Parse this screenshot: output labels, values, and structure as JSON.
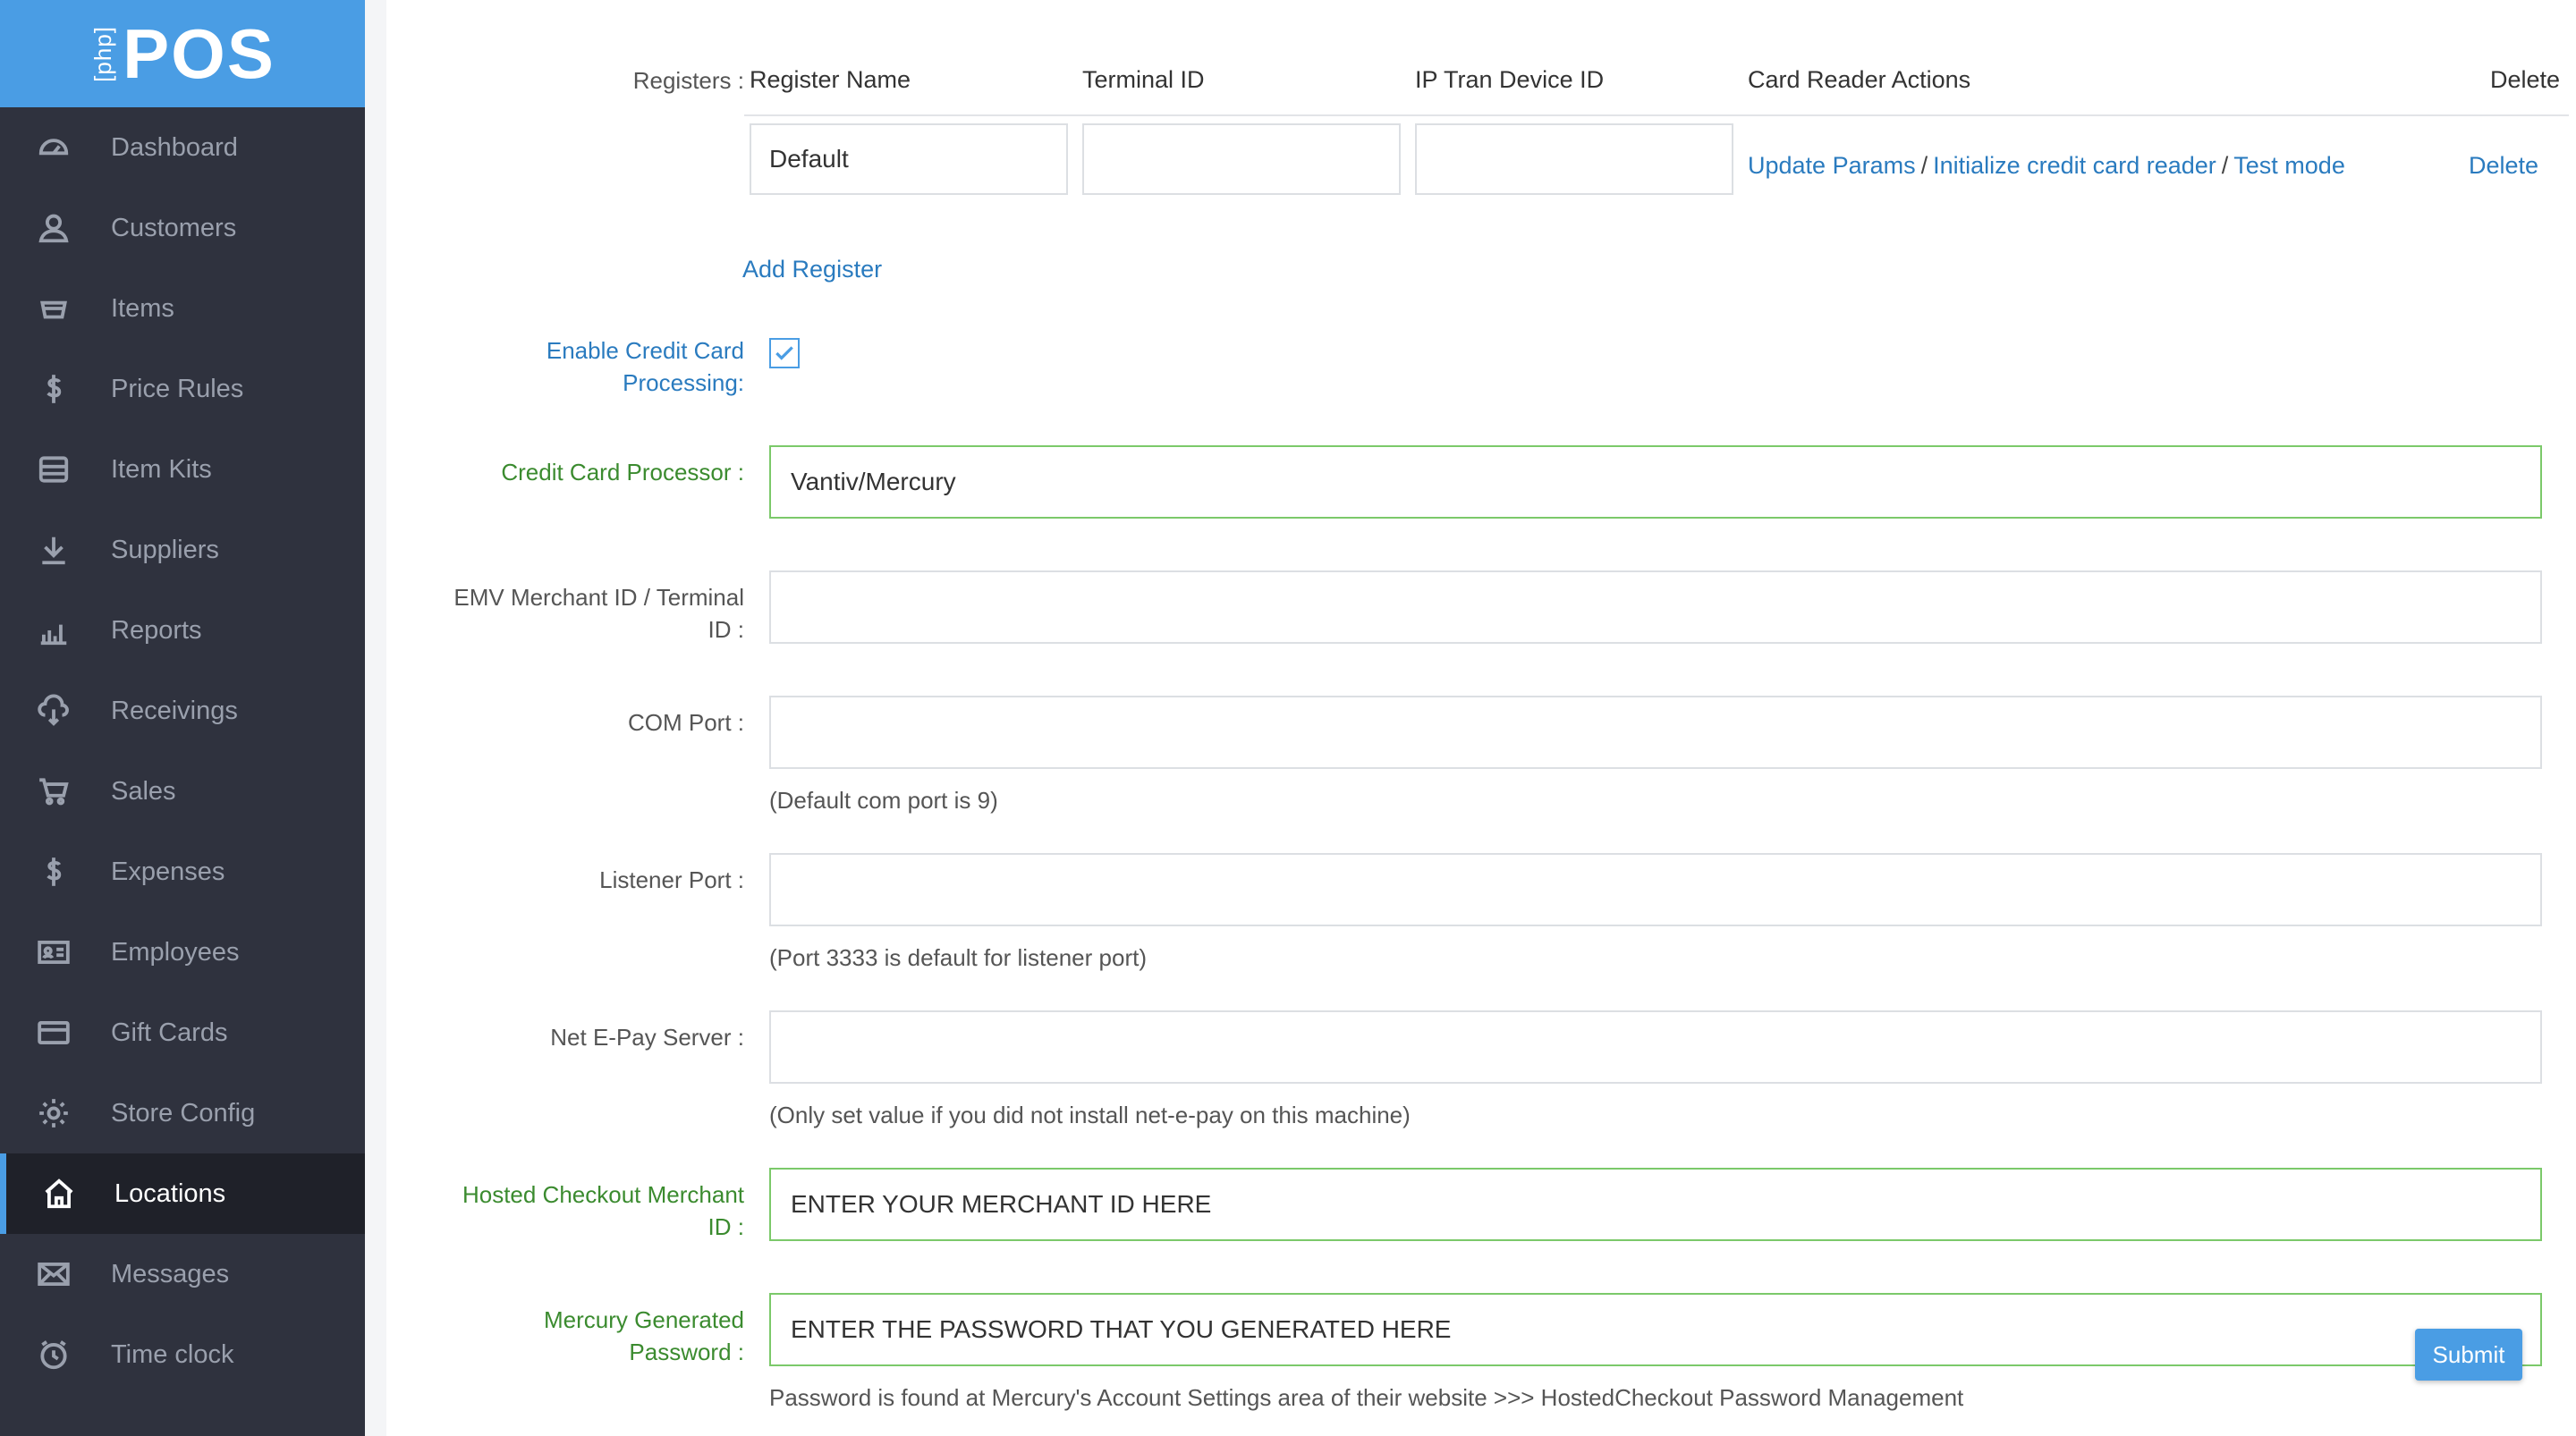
{
  "app": {
    "logo_prefix": "[php]",
    "logo_text": "POS",
    "brand_color": "#4a9de4"
  },
  "sidebar": {
    "items": [
      {
        "label": "Dashboard",
        "icon": "dashboard-icon"
      },
      {
        "label": "Customers",
        "icon": "user-icon"
      },
      {
        "label": "Items",
        "icon": "box-icon"
      },
      {
        "label": "Price Rules",
        "icon": "dollar-icon"
      },
      {
        "label": "Item Kits",
        "icon": "kit-icon"
      },
      {
        "label": "Suppliers",
        "icon": "download-icon"
      },
      {
        "label": "Reports",
        "icon": "bar-chart-icon"
      },
      {
        "label": "Receivings",
        "icon": "cloud-download-icon"
      },
      {
        "label": "Sales",
        "icon": "cart-icon"
      },
      {
        "label": "Expenses",
        "icon": "dollar-icon"
      },
      {
        "label": "Employees",
        "icon": "id-card-icon"
      },
      {
        "label": "Gift Cards",
        "icon": "credit-card-icon"
      },
      {
        "label": "Store Config",
        "icon": "gear-icon"
      },
      {
        "label": "Locations",
        "icon": "home-icon",
        "active": true
      },
      {
        "label": "Messages",
        "icon": "envelope-icon"
      },
      {
        "label": "Time clock",
        "icon": "clock-icon"
      }
    ]
  },
  "registers": {
    "label": "Registers :",
    "columns": [
      "Register Name",
      "Terminal ID",
      "IP Tran Device ID",
      "Card Reader Actions",
      "Delete"
    ],
    "rows": [
      {
        "register_name": "Default",
        "terminal_id": "",
        "ip_tran_device_id": "",
        "actions": [
          "Update Params",
          "Initialize credit card reader",
          "Test mode"
        ],
        "delete": "Delete"
      }
    ],
    "add_label": "Add Register",
    "separator": "/"
  },
  "form": {
    "enable_cc": {
      "label_line1": "Enable Credit Card",
      "label_line2": "Processing:",
      "checked": true
    },
    "processor": {
      "label": "Credit Card Processor :",
      "value": "Vantiv/Mercury"
    },
    "emv": {
      "label_line1": "EMV Merchant ID / Terminal",
      "label_line2": "ID :",
      "value": ""
    },
    "com_port": {
      "label": "COM Port :",
      "value": "",
      "hint": "(Default com port is 9)"
    },
    "listener_port": {
      "label": "Listener Port :",
      "value": "",
      "hint": "(Port 3333 is default for listener port)"
    },
    "net_epay": {
      "label": "Net E-Pay Server :",
      "value": "",
      "hint": "(Only set value if you did not install net-e-pay on this machine)"
    },
    "hosted_merchant": {
      "label_line1": "Hosted Checkout Merchant",
      "label_line2": "ID :",
      "value": "ENTER YOUR MERCHANT ID HERE"
    },
    "mercury_password": {
      "label_line1": "Mercury Generated",
      "label_line2": "Password :",
      "value": "ENTER THE PASSWORD THAT YOU GENERATED HERE",
      "hint": "Password is found at Mercury's Account Settings area of their website >>> HostedCheckout Password Management"
    }
  },
  "submit_label": "Submit"
}
